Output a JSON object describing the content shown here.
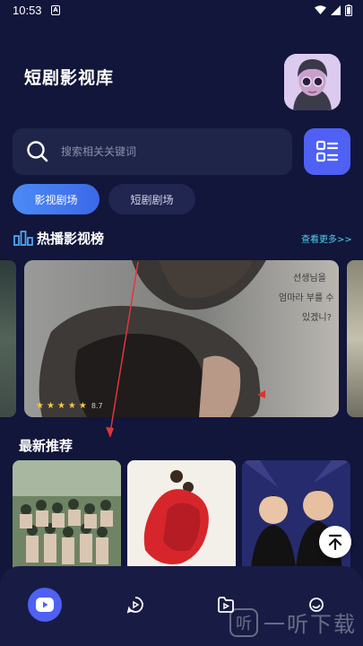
{
  "status_bar": {
    "time": "10:53",
    "app_icon_letter": "A"
  },
  "header": {
    "title": "短剧影视库"
  },
  "search": {
    "placeholder": "搜索相关关键词"
  },
  "tabs": [
    {
      "label": "影视剧场",
      "active": true
    },
    {
      "label": "短剧剧场",
      "active": false
    }
  ],
  "hot": {
    "title": "热播影视榜",
    "more_label": "查看更多>>",
    "banner": {
      "poster_text": [
        "선생님을",
        "엄마라 부를 수",
        "있겠니?"
      ],
      "rating_stars": 5,
      "rating_value": "8.7"
    }
  },
  "latest": {
    "title": "最新推荐"
  },
  "colors": {
    "background": "#11163a",
    "accent": "#4e61f4",
    "link": "#4fd0ea",
    "star": "#f6c644"
  },
  "nav": [
    {
      "icon": "play-icon"
    },
    {
      "icon": "theater-icon"
    },
    {
      "icon": "video-folder-icon"
    },
    {
      "icon": "profile-icon"
    }
  ],
  "watermark": {
    "text": "一听下载"
  }
}
